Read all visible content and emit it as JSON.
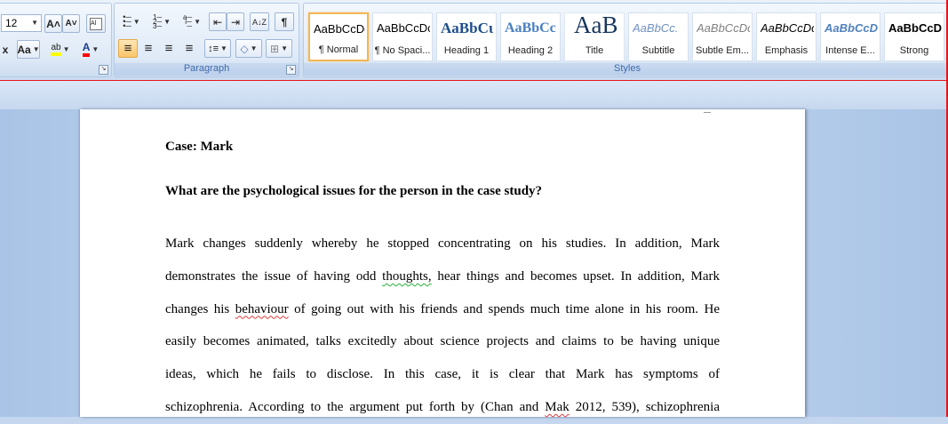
{
  "font_group": {
    "font_size": "12",
    "grow_font_icon": "A˄",
    "shrink_font_icon": "A˅",
    "clear_format_icon": "🖌",
    "change_case_label": "Aa",
    "highlight_label": "ab",
    "font_color_label": "A",
    "subscript_label": "x²"
  },
  "paragraph_group": {
    "label": "Paragraph",
    "bullets_icon": "☰",
    "numbering_icon": "☰",
    "multilevel_icon": "☰",
    "decrease_indent_icon": "⇤",
    "increase_indent_icon": "⇥",
    "sort_icon": "A↓Z",
    "pilcrow_icon": "¶",
    "align_left_icon": "≡",
    "center_icon": "≡",
    "align_right_icon": "≡",
    "justify_icon": "≡",
    "line_spacing_icon": "↕≡",
    "shading_icon": "◇",
    "borders_icon": "⊞"
  },
  "styles_group": {
    "label": "Styles",
    "items": [
      {
        "sample": "AaBbCcDc",
        "name": "¶ Normal"
      },
      {
        "sample": "AaBbCcDc",
        "name": "¶ No Spaci..."
      },
      {
        "sample": "AaBbCɩ",
        "name": "Heading 1"
      },
      {
        "sample": "AaBbCc",
        "name": "Heading 2"
      },
      {
        "sample": "AaB",
        "name": "Title"
      },
      {
        "sample": "AaBbCc.",
        "name": "Subtitle"
      },
      {
        "sample": "AaBbCcDc",
        "name": "Subtle Em..."
      },
      {
        "sample": "AaBbCcDc",
        "name": "Emphasis"
      },
      {
        "sample": "AaBbCcDc",
        "name": "Intense E..."
      },
      {
        "sample": "AaBbCcDc",
        "name": "Strong"
      }
    ]
  },
  "document": {
    "case_title": "Case: Mark",
    "question": "What are the psychological issues  for the person in the case study?",
    "lines": [
      [
        "Mark changes suddenly whereby he stopped concentrating on his studies. In addition, Mark"
      ],
      [
        "demonstrates the issue of having odd ",
        "thoughts,",
        " hear things and becomes upset. In addition, Mark"
      ],
      [
        "changes his ",
        "behaviour",
        " of going out with his friends and spends much time alone in his room. He"
      ],
      [
        "easily becomes animated, talks excitedly about science projects and claims to be having unique"
      ],
      [
        "ideas, which he fails to disclose. In this case, it is clear that Mark has symptoms of"
      ],
      [
        "schizophrenia. According to the argument put forth by (Chan and ",
        "Mak",
        " 2012, 539), schizophrenia"
      ]
    ]
  },
  "colors": {
    "ribbon_accent": "#3e6aaa",
    "selected_style": "#f2b756",
    "active_button": "#f9c56a",
    "frame_red": "#e8141b",
    "highlight_yellow": "#ffff00",
    "font_color_red": "#ff0000"
  }
}
